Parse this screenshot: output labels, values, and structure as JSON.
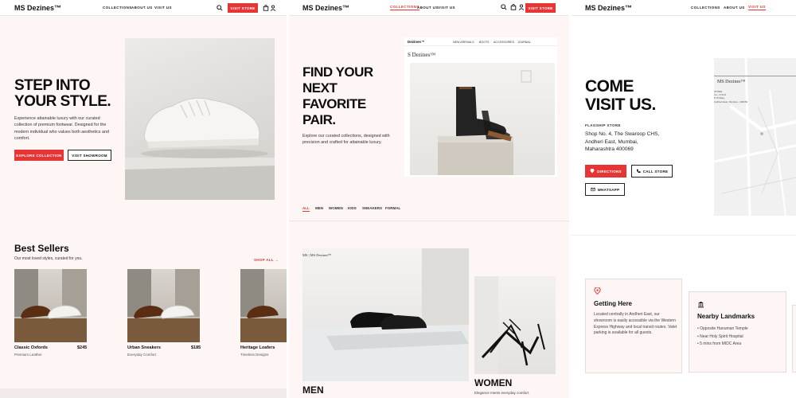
{
  "brand": "MS Dezines™",
  "panel1": {
    "nav": {
      "links": [
        "COLLECTIONS",
        "ABOUT US",
        "VISIT US"
      ],
      "cta": "VISIT STORE"
    },
    "hero": {
      "title_line1": "STEP INTO",
      "title_line2": "YOUR STYLE.",
      "description": "Experience attainable luxury with our curated collection of premium footwear. Designed for the modern individual who values both aesthetics and comfort.",
      "primary_button": "EXPLORE COLLECTION",
      "secondary_button": "VISIT SHOWROOM"
    },
    "best_sellers": {
      "title": "Best Sellers",
      "subtitle": "Our most loved styles, curated for you.",
      "shop_all": "SHOP ALL →",
      "products": [
        {
          "name": "Classic Oxfords",
          "material": "Premium Leather",
          "price": "$245"
        },
        {
          "name": "Urban Sneakers",
          "material": "Everyday Comfort",
          "price": "$185"
        },
        {
          "name": "Heritage Loafers",
          "material": "Timeless Designs",
          "price": ""
        }
      ]
    }
  },
  "panel2": {
    "nav": {
      "links": [
        "COLLECTIONS",
        "ABOUT US",
        "VISIT US"
      ],
      "cta": "VISIT STORE"
    },
    "hero": {
      "title_line1": "FIND YOUR",
      "title_line2": "NEXT",
      "title_line3": "FAVORITE",
      "title_line4": "PAIR.",
      "description": "Explore our curated collections, designed with precision and crafted for attainable luxury."
    },
    "mini_site": {
      "logo": "S Dezines™",
      "logo_small": "Dezines™",
      "links": [
        "NEW ARRIVALS",
        "BOOTS",
        "ACCESSORIES",
        "JOURNAL"
      ]
    },
    "filters": [
      "ALL",
      "MEN",
      "WOMEN",
      "KIDS",
      "SNEAKERS",
      "FORMAL"
    ],
    "storefront_sign": "MS | MS Dezines™",
    "categories": [
      {
        "label": "MEN"
      },
      {
        "label": "WOMEN",
        "caption": "Elegance meets everyday comfort."
      }
    ]
  },
  "panel3": {
    "nav": {
      "links": [
        "COLLECTIONS",
        "ABOUT US",
        "VISIT US"
      ]
    },
    "hero": {
      "title_line1": "COME",
      "title_line2": "VISIT US.",
      "store_label": "FLAGSHIP STORE",
      "address_line1": "Shop No. 4, The Swaroop CHS,",
      "address_line2": "Andheri East, Mumbai,",
      "address_line3": "Maharashtra 400069",
      "directions_button": "DIRECTIONS",
      "call_button": "CALL STORE",
      "whatsapp_button": "WHATSAPP"
    },
    "map": {
      "logo": "MS Dezines™",
      "lines": [
        "STORE",
        "Co., N.W.R.",
        "N M Marg",
        "Andheri East, Mumbai - 400069"
      ]
    },
    "getting_here": {
      "title": "Getting Here",
      "text": "Located centrally in Andheri East, our showroom is easily accessible via the Western Express Highway and local transit routes. Valet parking is available for all guests."
    },
    "landmarks": {
      "title": "Nearby Landmarks",
      "items": [
        "Opposite Hanuman Temple",
        "Near Holy Spirit Hospital",
        "5 mins from MIDC Area"
      ]
    }
  },
  "colors": {
    "accent": "#e53535",
    "bg_blush": "#fdf6f5",
    "text": "#0d0d0d"
  },
  "icons": [
    "search-icon",
    "bag-icon",
    "user-icon",
    "location-pin-icon",
    "phone-icon",
    "whatsapp-icon",
    "landmark-icon"
  ]
}
